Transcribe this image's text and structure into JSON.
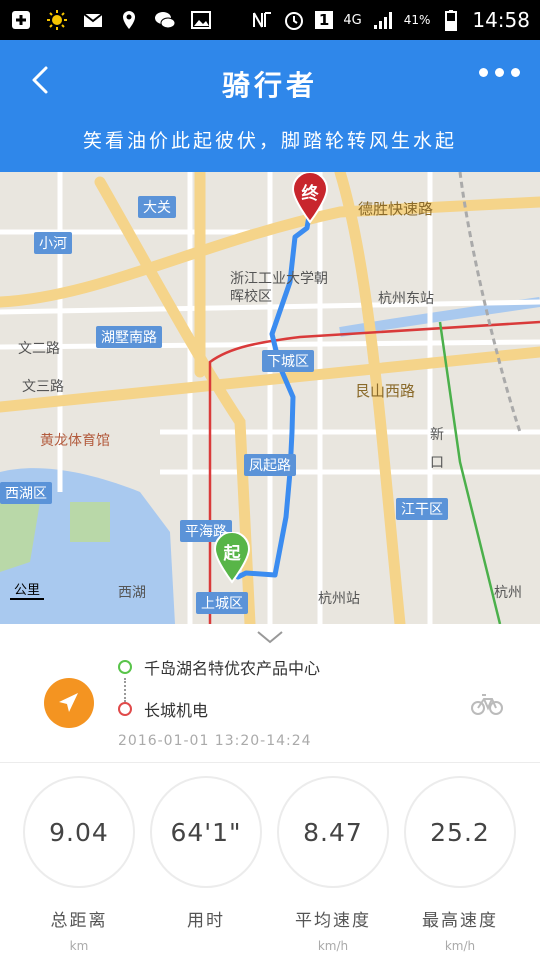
{
  "status_bar": {
    "network": "4G",
    "battery": "41%",
    "sim": "1",
    "time": "14:58",
    "icons": [
      "plus-icon",
      "sun-icon",
      "mail-icon",
      "location-icon",
      "wechat-icon",
      "image-icon",
      "nfc-icon",
      "alarm-icon",
      "sim-icon",
      "signal-icon",
      "battery-icon"
    ]
  },
  "header": {
    "title": "骑行者",
    "slogan": "笑看油价此起彼伏，脚踏轮转风生水起",
    "color": "#2f87ea"
  },
  "map": {
    "labels": {
      "da_guan": "大关",
      "xiao_he": "小河",
      "desheng_road": "德胜快速路",
      "zju": "浙江工业大学朝晖校区",
      "hangzhou_east": "杭州东站",
      "hushu_south": "湖墅南路",
      "road_2": "文二路",
      "road_3": "文三路",
      "xiacheng": "下城区",
      "genshan_west": "艮山西路",
      "huanglong": "黄龙体育馆",
      "xihu_district": "西湖区",
      "fengqi": "凤起路",
      "jianggan": "江干区",
      "pinghai": "平海路",
      "xihu": "西湖",
      "shangcheng": "上城区",
      "hangzhou_station": "杭州站",
      "hangzhou_right": "杭州",
      "partial_jian": "新",
      "partial_kou": "口",
      "scale": "公里"
    },
    "start_pin": "起",
    "end_pin": "终"
  },
  "trip": {
    "start": "千岛湖名特优农产品中心",
    "end": "长城机电",
    "time": "2016-01-01 13:20-14:24"
  },
  "stats": [
    {
      "value": "9.04",
      "label": "总距离",
      "unit": "km"
    },
    {
      "value": "64'1\"",
      "label": "用时",
      "unit": ""
    },
    {
      "value": "8.47",
      "label": "平均速度",
      "unit": "km/h"
    },
    {
      "value": "25.2",
      "label": "最高速度",
      "unit": "km/h"
    }
  ],
  "colors": {
    "accent": "#2f87ea",
    "route": "#3b8cf0",
    "nav_button": "#f49421",
    "start": "#59c44a",
    "end": "#e04a4a"
  }
}
